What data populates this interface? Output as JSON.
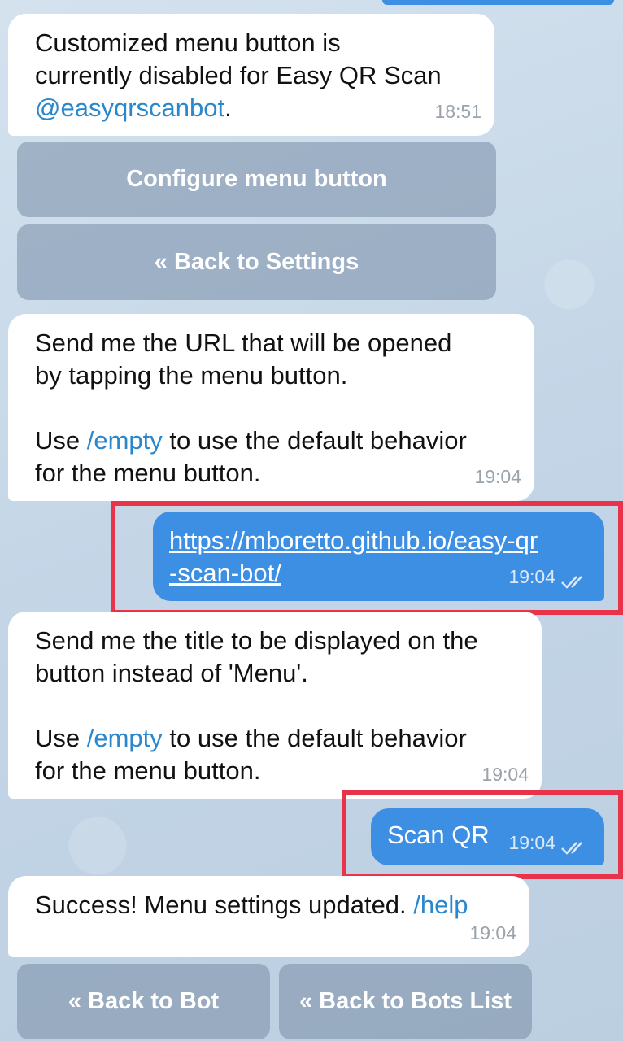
{
  "messages": [
    {
      "id": "m1",
      "direction": "incoming",
      "lines": [
        "Customized menu button is",
        "currently disabled for Easy QR Scan"
      ],
      "mention": "@easyqrscanbot",
      "mention_suffix": ".",
      "time": "18:51"
    },
    {
      "id": "m2",
      "direction": "incoming",
      "line1": "Send me the URL that will be opened",
      "line2": "by tapping the menu button.",
      "use_prefix": "Use ",
      "command": "/empty",
      "use_suffix": " to use the default behavior",
      "line4": "for the menu button.",
      "time": "19:04"
    },
    {
      "id": "m3",
      "direction": "outgoing",
      "url_line1": "https://mboretto.github.io/easy-qr",
      "url_line2": "-scan-bot/",
      "time": "19:04"
    },
    {
      "id": "m4",
      "direction": "incoming",
      "line1": "Send me the title to be displayed on the",
      "line2": "button instead of 'Menu'.",
      "use_prefix": "Use ",
      "command": "/empty",
      "use_suffix": " to use the default behavior",
      "line4": "for the menu button.",
      "time": "19:04"
    },
    {
      "id": "m5",
      "direction": "outgoing",
      "text": "Scan QR",
      "time": "19:04"
    },
    {
      "id": "m6",
      "direction": "incoming",
      "text": "Success! Menu settings updated. ",
      "command": "/help",
      "time": "19:04"
    }
  ],
  "keyboard1": {
    "configure": "Configure menu button",
    "back_settings": "« Back to Settings"
  },
  "keyboard2": {
    "back_bot": "« Back to Bot",
    "back_bots_list": "« Back to Bots List"
  },
  "colors": {
    "outgoing_bubble": "#3d8fe3",
    "incoming_bubble": "#ffffff",
    "link": "#2b87cc",
    "highlight": "#e8334a"
  }
}
